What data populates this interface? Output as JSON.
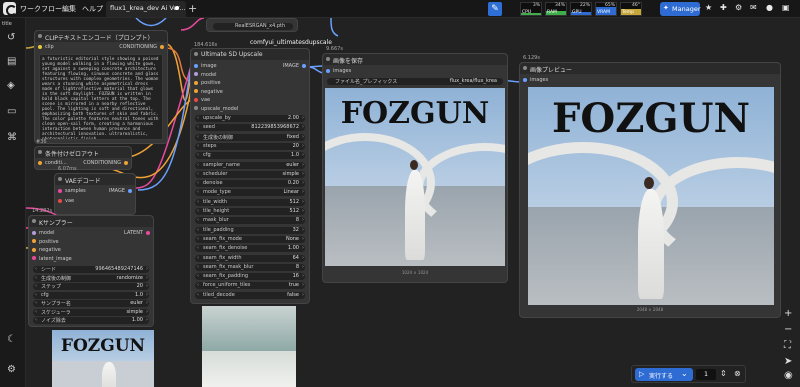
{
  "menu": {
    "workflow": "ワークフロー",
    "edit": "編集",
    "help": "ヘルプ",
    "tab_title": "flux1_krea_dev Ai Ver..."
  },
  "resources": [
    {
      "label": "CPU",
      "pct": "3%",
      "color": "#3fae4a",
      "fraction": 0.03
    },
    {
      "label": "RAM",
      "pct": "34%",
      "color": "#3fae4a",
      "fraction": 0.34
    },
    {
      "label": "GPU",
      "pct": "22%",
      "color": "#2e6cd4",
      "fraction": 0.22
    },
    {
      "label": "VRAM",
      "pct": "65%",
      "color": "#2e6cd4",
      "fraction": 0.65
    },
    {
      "label": "Temp",
      "pct": "46°",
      "color": "#c7a63a",
      "fraction": 0.46
    }
  ],
  "toolbar": {
    "manager_label": "Manager"
  },
  "sidebar": {
    "title": "title"
  },
  "nodes": {
    "clip": {
      "title": "CLIPテキストエンコード（プロンプト）",
      "input_clip": "clip",
      "output": "CONDITIONING",
      "prompt": "a futuristic editorial style showing a poised young model walking in a flowing white gown, set against a sweeping concrete architecture featuring flowing, sinuous concrete and glass structures with complex geometries. The woman wears a stunning white asymmetrical dress made of lightreflective material that glows in the soft daylight. FOZGUN is written in bold black capital letters at the top. The scene is mirrored in a nearby reflective pool. The lighting is soft and directional, emphasizing both textures of skin and fabric. The color palette features neutral tones with clean open-sail form, creating a harmonious interaction between human presence and architectural innovation. ultrarealistic, photorealistic finish"
    },
    "cond": {
      "id": "#36",
      "title": "条件付けゼロアウト",
      "input": "conditi...",
      "output": "CONDITIONING"
    },
    "vae": {
      "id": "6.07ms",
      "title": "VAEデコード",
      "in1": "samples",
      "in2": "vae",
      "output": "IMAGE"
    },
    "ksampler": {
      "id": "14.282s",
      "title": "Kサンプラー",
      "slots": [
        "model",
        "positive",
        "negative",
        "latent_image"
      ],
      "output": "LATENT",
      "widgets": [
        {
          "label": "シード",
          "value": "996465489247146"
        },
        {
          "label": "生成後の制御",
          "value": "randomize"
        },
        {
          "label": "ステップ",
          "value": "20"
        },
        {
          "label": "cfg",
          "value": "1.0"
        },
        {
          "label": "サンプラー名",
          "value": "euler"
        },
        {
          "label": "スケジューラ",
          "value": "simple"
        },
        {
          "label": "ノイズ除去",
          "value": "1.00"
        }
      ]
    },
    "upscale": {
      "id": "184.616s",
      "title": "Ultimate SD Upscale",
      "inputs": [
        "image",
        "model",
        "positive",
        "negative",
        "vae",
        "upscale_model"
      ],
      "output": "IMAGE",
      "widgets": [
        {
          "label": "upscale_by",
          "value": "2.00"
        },
        {
          "label": "seed",
          "value": "812239853968672"
        },
        {
          "label": "生成後の制御",
          "value": "fixed"
        },
        {
          "label": "steps",
          "value": "20"
        },
        {
          "label": "cfg",
          "value": "1.0"
        },
        {
          "label": "sampler_name",
          "value": "euler"
        },
        {
          "label": "scheduler",
          "value": "simple"
        },
        {
          "label": "denoise",
          "value": "0.20"
        },
        {
          "label": "mode_type",
          "value": "Linear"
        },
        {
          "label": "tile_width",
          "value": "512"
        },
        {
          "label": "tile_height",
          "value": "512"
        },
        {
          "label": "mask_blur",
          "value": "8"
        },
        {
          "label": "tile_padding",
          "value": "32"
        },
        {
          "label": "seam_fix_mode",
          "value": "None"
        },
        {
          "label": "seam_fix_denoise",
          "value": "1.00"
        },
        {
          "label": "seam_fix_width",
          "value": "64"
        },
        {
          "label": "seam_fix_mask_blur",
          "value": "8"
        },
        {
          "label": "seam_fix_padding",
          "value": "16"
        },
        {
          "label": "force_uniform_tiles",
          "value": "true"
        },
        {
          "label": "tiled_decode",
          "value": "false"
        }
      ]
    },
    "model_loader": {
      "file": "RealESRGAN_x4.pth",
      "group": "comfyui_ultimatesdupscale"
    },
    "save": {
      "id": "9.667s",
      "title": "画像を保存",
      "input": "images",
      "prefix_label": "ファイル名_プレフィックス",
      "prefix_value": "flux_krea/flux_krea",
      "caption": "1024 × 1024"
    },
    "preview": {
      "id": "6.129s",
      "title": "画像プレビュー",
      "input": "images",
      "caption": "2048 × 2048"
    }
  },
  "image_text": "FOZGUN",
  "runbar": {
    "run_label": "実行する",
    "count": "1"
  }
}
